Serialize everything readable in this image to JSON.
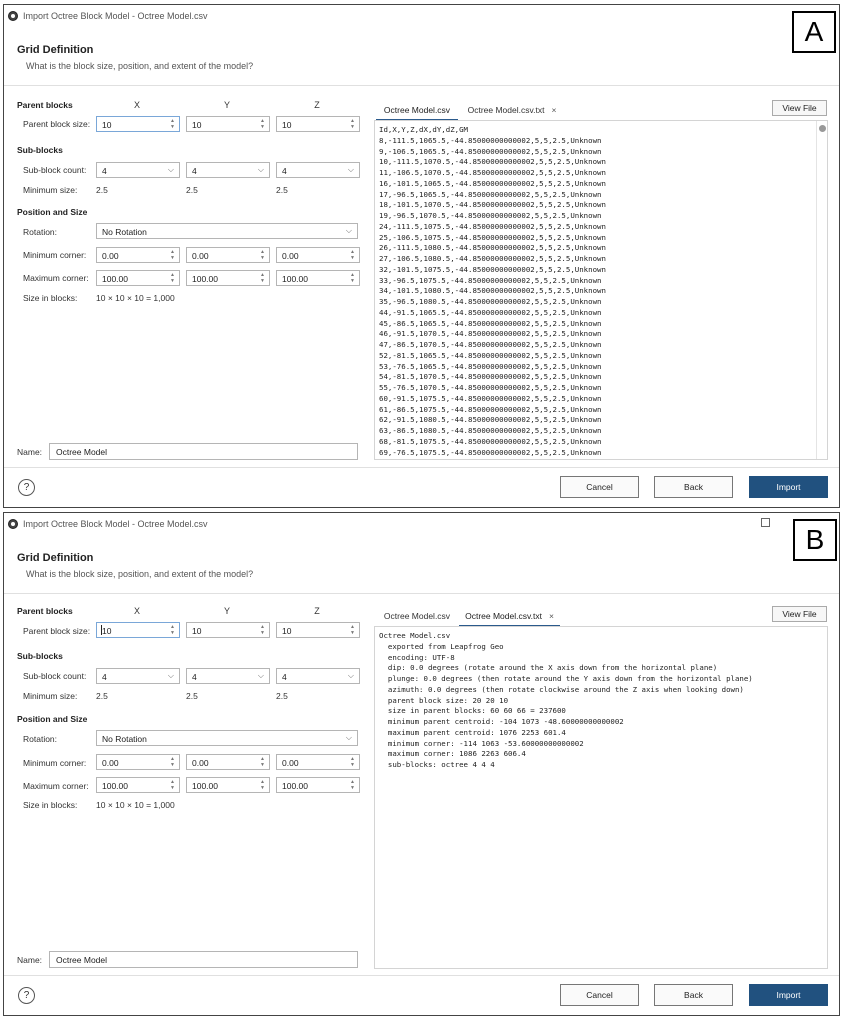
{
  "panels": [
    {
      "label": "A",
      "window": {
        "title": "Import Octree Block Model - Octree Model.csv"
      },
      "header": {
        "title": "Grid Definition",
        "subtitle": "What is the block size, position, and extent of the model?"
      },
      "columns": [
        "X",
        "Y",
        "Z"
      ],
      "parent_blocks": {
        "section": "Parent blocks",
        "label": "Parent block size:",
        "values": [
          "10",
          "10",
          "10"
        ]
      },
      "sub_blocks": {
        "section": "Sub-blocks",
        "count_label": "Sub-block count:",
        "counts": [
          "4",
          "4",
          "4"
        ],
        "min_label": "Minimum size:",
        "min": [
          "2.5",
          "2.5",
          "2.5"
        ]
      },
      "position": {
        "section": "Position and Size",
        "rotation_label": "Rotation:",
        "rotation": "No Rotation",
        "min_label": "Minimum corner:",
        "min": [
          "0.00",
          "0.00",
          "0.00"
        ],
        "max_label": "Maximum corner:",
        "max": [
          "100.00",
          "100.00",
          "100.00"
        ],
        "size_label": "Size in blocks:",
        "size": "10 × 10 × 10 = 1,000"
      },
      "name": {
        "label": "Name:",
        "value": "Octree Model"
      },
      "tabs": [
        {
          "label": "Octree Model.csv",
          "active": true
        },
        {
          "label": "Octree Model.csv.txt",
          "active": false,
          "close": "×"
        }
      ],
      "view_file": "View File",
      "content": [
        "Id,X,Y,Z,dX,dY,dZ,GM",
        "8,-111.5,1065.5,-44.85000000000002,5,5,2.5,Unknown",
        "9,-106.5,1065.5,-44.85000000000002,5,5,2.5,Unknown",
        "10,-111.5,1070.5,-44.85000000000002,5,5,2.5,Unknown",
        "11,-106.5,1070.5,-44.85000000000002,5,5,2.5,Unknown",
        "16,-101.5,1065.5,-44.85000000000002,5,5,2.5,Unknown",
        "17,-96.5,1065.5,-44.85000000000002,5,5,2.5,Unknown",
        "18,-101.5,1070.5,-44.85000000000002,5,5,2.5,Unknown",
        "19,-96.5,1070.5,-44.85000000000002,5,5,2.5,Unknown",
        "24,-111.5,1075.5,-44.85000000000002,5,5,2.5,Unknown",
        "25,-106.5,1075.5,-44.85000000000002,5,5,2.5,Unknown",
        "26,-111.5,1080.5,-44.85000000000002,5,5,2.5,Unknown",
        "27,-106.5,1080.5,-44.85000000000002,5,5,2.5,Unknown",
        "32,-101.5,1075.5,-44.85000000000002,5,5,2.5,Unknown",
        "33,-96.5,1075.5,-44.85000000000002,5,5,2.5,Unknown",
        "34,-101.5,1080.5,-44.85000000000002,5,5,2.5,Unknown",
        "35,-96.5,1080.5,-44.85000000000002,5,5,2.5,Unknown",
        "44,-91.5,1065.5,-44.85000000000002,5,5,2.5,Unknown",
        "45,-86.5,1065.5,-44.85000000000002,5,5,2.5,Unknown",
        "46,-91.5,1070.5,-44.85000000000002,5,5,2.5,Unknown",
        "47,-86.5,1070.5,-44.85000000000002,5,5,2.5,Unknown",
        "52,-81.5,1065.5,-44.85000000000002,5,5,2.5,Unknown",
        "53,-76.5,1065.5,-44.85000000000002,5,5,2.5,Unknown",
        "54,-81.5,1070.5,-44.85000000000002,5,5,2.5,Unknown",
        "55,-76.5,1070.5,-44.85000000000002,5,5,2.5,Unknown",
        "60,-91.5,1075.5,-44.85000000000002,5,5,2.5,Unknown",
        "61,-86.5,1075.5,-44.85000000000002,5,5,2.5,Unknown",
        "62,-91.5,1080.5,-44.85000000000002,5,5,2.5,Unknown",
        "63,-86.5,1080.5,-44.85000000000002,5,5,2.5,Unknown",
        "68,-81.5,1075.5,-44.85000000000002,5,5,2.5,Unknown",
        "69,-76.5,1075.5,-44.85000000000002,5,5,2.5,Unknown"
      ],
      "buttons": {
        "cancel": "Cancel",
        "back": "Back",
        "import": "Import"
      },
      "help": "?"
    },
    {
      "label": "B",
      "window": {
        "title": "Import Octree Block Model - Octree Model.csv"
      },
      "header": {
        "title": "Grid Definition",
        "subtitle": "What is the block size, position, and extent of the model?"
      },
      "columns": [
        "X",
        "Y",
        "Z"
      ],
      "parent_blocks": {
        "section": "Parent blocks",
        "label": "Parent block size:",
        "values": [
          "10",
          "10",
          "10"
        ]
      },
      "sub_blocks": {
        "section": "Sub-blocks",
        "count_label": "Sub-block count:",
        "counts": [
          "4",
          "4",
          "4"
        ],
        "min_label": "Minimum size:",
        "min": [
          "2.5",
          "2.5",
          "2.5"
        ]
      },
      "position": {
        "section": "Position and Size",
        "rotation_label": "Rotation:",
        "rotation": "No Rotation",
        "min_label": "Minimum corner:",
        "min": [
          "0.00",
          "0.00",
          "0.00"
        ],
        "max_label": "Maximum corner:",
        "max": [
          "100.00",
          "100.00",
          "100.00"
        ],
        "size_label": "Size in blocks:",
        "size": "10 × 10 × 10 = 1,000"
      },
      "name": {
        "label": "Name:",
        "value": "Octree Model"
      },
      "tabs": [
        {
          "label": "Octree Model.csv",
          "active": false
        },
        {
          "label": "Octree Model.csv.txt",
          "active": true,
          "close": "×"
        }
      ],
      "view_file": "View File",
      "content": [
        "Octree Model.csv",
        "  exported from Leapfrog Geo",
        "  encoding: UTF-8",
        "  dip: 0.0 degrees (rotate around the X axis down from the horizontal plane)",
        "  plunge: 0.0 degrees (then rotate around the Y axis down from the horizontal plane)",
        "  azimuth: 0.0 degrees (then rotate clockwise around the Z axis when looking down)",
        "  parent block size: 20 20 10",
        "  size in parent blocks: 60 60 66 = 237600",
        "  minimum parent centroid: -104 1073 -48.60000000000002",
        "  maximum parent centroid: 1076 2253 601.4",
        "  minimum corner: -114 1063 -53.60000000000002",
        "  maximum corner: 1086 2263 606.4",
        "  sub-blocks: octree 4 4 4"
      ],
      "buttons": {
        "cancel": "Cancel",
        "back": "Back",
        "import": "Import"
      },
      "help": "?"
    }
  ]
}
